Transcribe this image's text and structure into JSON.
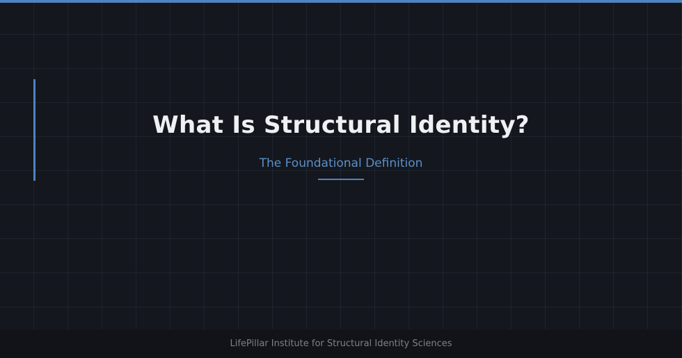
{
  "slide": {
    "title": "What Is Structural Identity?",
    "subtitle": "The Foundational Definition"
  },
  "footer": {
    "text": "LifePillar Institute for Structural Identity Sciences"
  },
  "colors": {
    "background": "#14171e",
    "accent": "#4f84c1",
    "title": "#eef0f3",
    "footer_background": "#111318",
    "footer_text": "#7b808a"
  }
}
